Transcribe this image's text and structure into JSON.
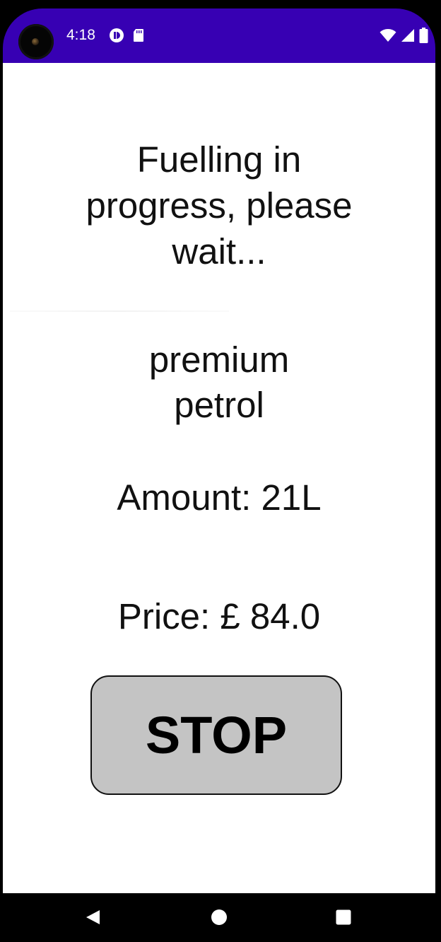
{
  "status_bar": {
    "time": "4:18",
    "color": "#3700b3",
    "notification_icons": [
      "tracker-icon",
      "sd-card-icon"
    ],
    "system_icons": [
      "wifi-icon",
      "signal-icon",
      "battery-icon"
    ]
  },
  "screen": {
    "heading_lines": [
      "Fuelling in",
      "progress, please",
      "wait..."
    ],
    "fuel_type_lines": [
      "premium",
      "petrol"
    ],
    "amount": "Amount: 21L",
    "price": "Price: £ 84.0",
    "stop_label": "STOP",
    "stop_button_color": "#c4c4c4"
  },
  "nav_bar": {
    "buttons": [
      "back-icon",
      "home-icon",
      "recents-icon"
    ]
  }
}
